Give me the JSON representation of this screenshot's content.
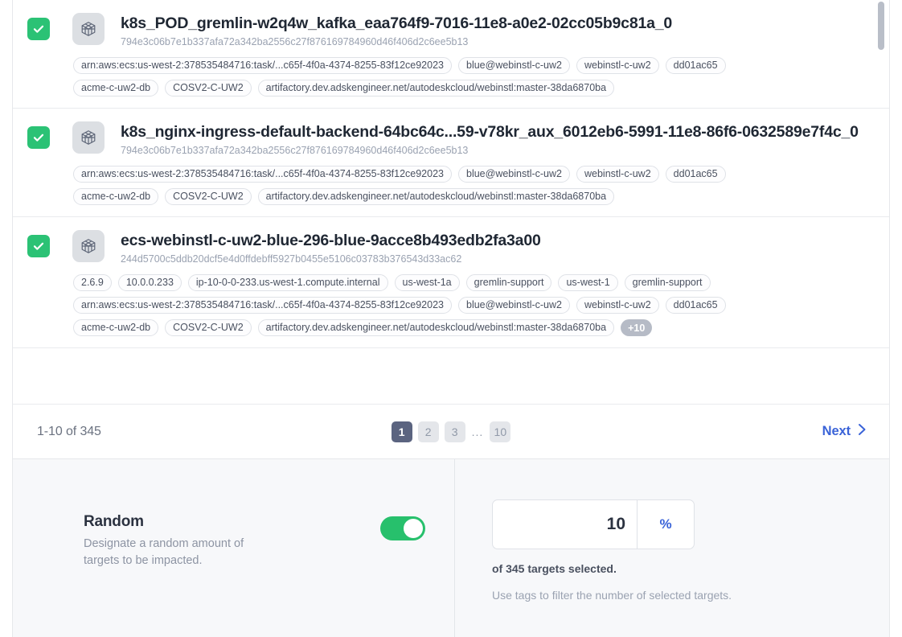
{
  "target_list": {
    "scrollbar": {
      "name": "vertical-scrollbar"
    },
    "rows": [
      {
        "checkbox_checked": true,
        "icon": "cube-icon",
        "title": "k8s_POD_gremlin-w2q4w_kafka_eaa764f9-7016-11e8-a0e2-02cc05b9c81a_0",
        "subtitle": "794e3c06b7e1b337afa72a342ba2556c27f876169784960d46f406d2c6ee5b13",
        "tag_lines": [
          [
            "arn:aws:ecs:us-west-2:378535484716:task/...c65f-4f0a-4374-8255-83f12ce92023",
            "blue@webinstl-c-uw2",
            "webinstl-c-uw2",
            "dd01ac65"
          ],
          [
            "acme-c-uw2-db",
            "COSV2-C-UW2",
            "artifactory.dev.adskengineer.net/autodeskcloud/webinstl:master-38da6870ba"
          ]
        ]
      },
      {
        "checkbox_checked": true,
        "icon": "cube-icon",
        "title": "k8s_nginx-ingress-default-backend-64bc64c...59-v78kr_aux_6012eb6-5991-11e8-86f6-0632589e7f4c_0",
        "subtitle": "794e3c06b7e1b337afa72a342ba2556c27f876169784960d46f406d2c6ee5b13",
        "tag_lines": [
          [
            "arn:aws:ecs:us-west-2:378535484716:task/...c65f-4f0a-4374-8255-83f12ce92023",
            "blue@webinstl-c-uw2",
            "webinstl-c-uw2",
            "dd01ac65"
          ],
          [
            "acme-c-uw2-db",
            "COSV2-C-UW2",
            "artifactory.dev.adskengineer.net/autodeskcloud/webinstl:master-38da6870ba"
          ]
        ]
      },
      {
        "checkbox_checked": true,
        "icon": "cube-icon",
        "title": "ecs-webinstl-c-uw2-blue-296-blue-9acce8b493edb2fa3a00",
        "subtitle": "244d5700c5ddb20dcf5e4d0ffdebff5927b0455e5106c03783b376543d33ac62",
        "tag_lines": [
          [
            "2.6.9",
            "10.0.0.233",
            "ip-10-0-0-233.us-west-1.compute.internal",
            "us-west-1a",
            "gremlin-support",
            "us-west-1",
            "gremlin-support"
          ],
          [
            "arn:aws:ecs:us-west-2:378535484716:task/...c65f-4f0a-4374-8255-83f12ce92023",
            "blue@webinstl-c-uw2",
            "webinstl-c-uw2",
            "dd01ac65"
          ],
          [
            "acme-c-uw2-db",
            "COSV2-C-UW2",
            "artifactory.dev.adskengineer.net/autodeskcloud/webinstl:master-38da6870ba"
          ]
        ],
        "more_tags_badge": "+10"
      }
    ]
  },
  "pagination": {
    "range_label": "1-10 of 345",
    "pages": [
      "1",
      "2",
      "3"
    ],
    "active_page": "1",
    "ellipsis": "...",
    "last_page": "10",
    "next_label": "Next",
    "next_icon": "chevron-right-icon"
  },
  "settings": {
    "random": {
      "title": "Random",
      "description": "Designate a random amount of targets to be impacted.",
      "toggle_on": true
    },
    "amount": {
      "value": "10",
      "unit": "%",
      "selected_label": "of 345 targets selected.",
      "hint": "Use tags to filter the number of selected targets."
    }
  },
  "colors": {
    "checkbox_green": "#2bc275",
    "toggle_green": "#27c06c",
    "link_blue": "#3a63d8",
    "active_page_bg": "#5b6480",
    "panel_bg": "#f7f8fa"
  }
}
